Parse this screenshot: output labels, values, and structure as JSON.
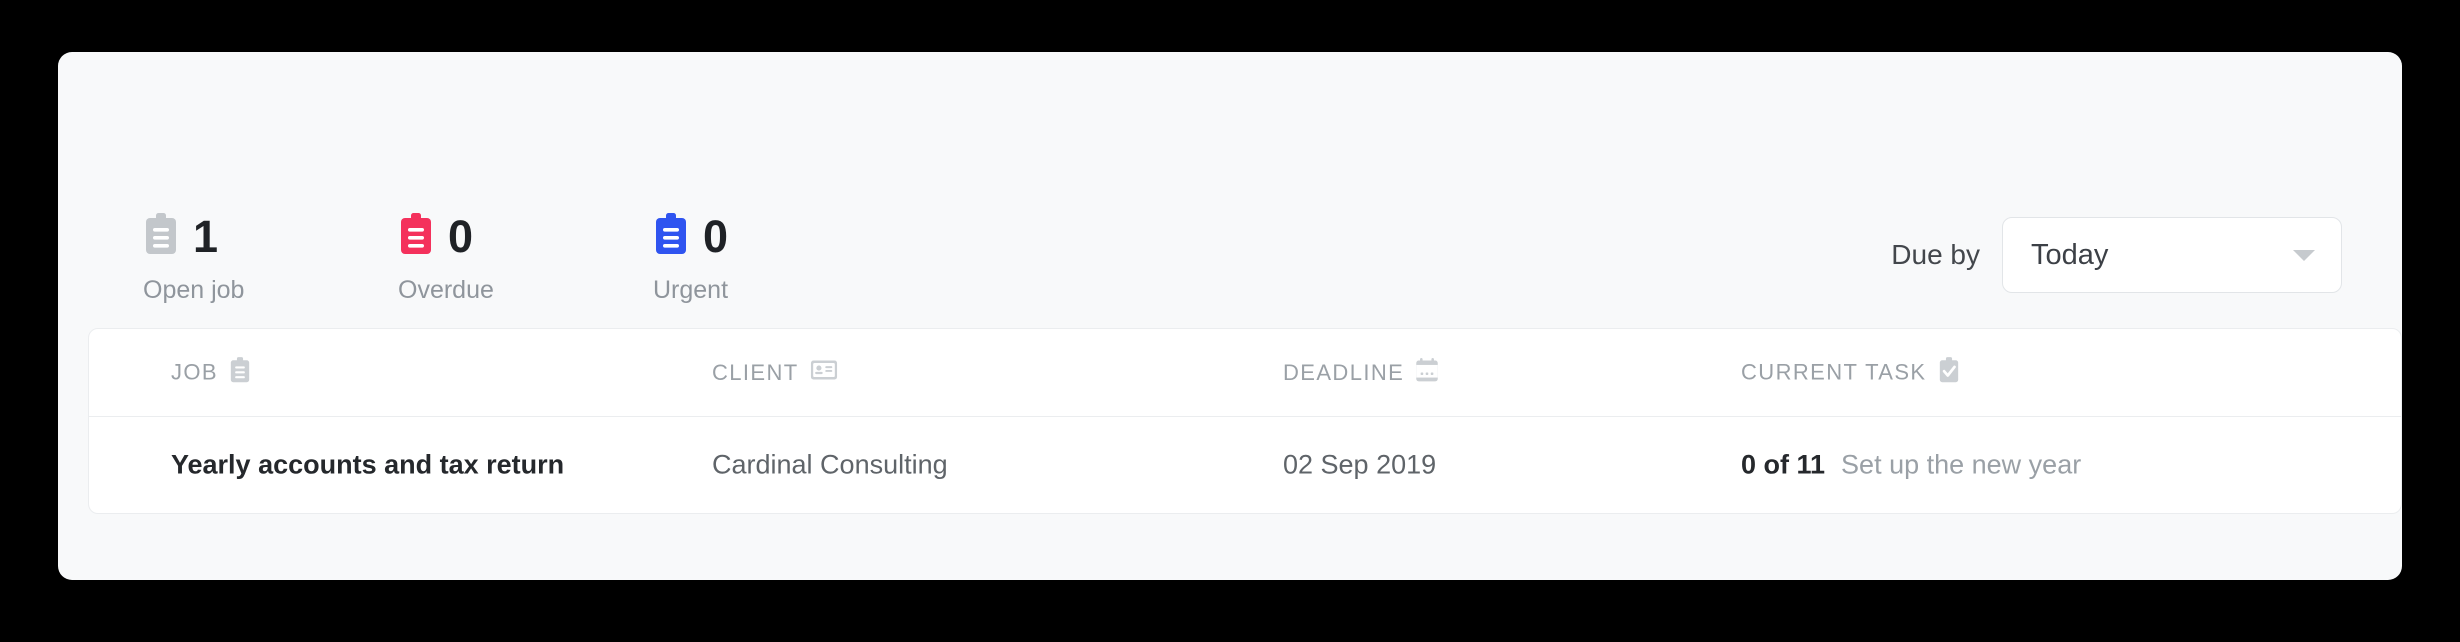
{
  "card": {
    "summary": {
      "stats": [
        {
          "count": "1",
          "label": "Open job",
          "icon": "clipboard-icon",
          "color": "#c3c7cb"
        },
        {
          "count": "0",
          "label": "Overdue",
          "icon": "clipboard-icon",
          "color": "#f4315c"
        },
        {
          "count": "0",
          "label": "Urgent",
          "icon": "clipboard-icon",
          "color": "#2f54f0"
        }
      ],
      "due_by": {
        "label": "Due by",
        "selected": "Today",
        "options": [
          "Today"
        ],
        "caret_icon": "chevron-down-icon"
      }
    },
    "table": {
      "columns": [
        {
          "label": "JOB",
          "icon": "clipboard-icon"
        },
        {
          "label": "CLIENT",
          "icon": "id-card-icon"
        },
        {
          "label": "DEADLINE",
          "icon": "calendar-icon"
        },
        {
          "label": "CURRENT TASK",
          "icon": "clipboard-check-icon"
        }
      ],
      "rows": [
        {
          "job": "Yearly accounts and tax return",
          "client": "Cardinal Consulting",
          "deadline": "02 Sep 2019",
          "task_count": "0 of 11",
          "task_name": "Set up the new year"
        }
      ]
    }
  },
  "colors": {
    "page_background": "#000000",
    "card_background": "#f8f9fa",
    "panel_background": "#ffffff",
    "border": "#ebedef",
    "text_primary": "#25282c",
    "text_secondary": "#5f6469",
    "text_muted": "#9aa0a6",
    "accent_red": "#f4315c",
    "accent_blue": "#2f54f0",
    "accent_gray": "#c3c7cb"
  }
}
